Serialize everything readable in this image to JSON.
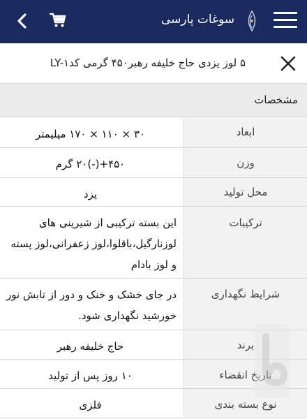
{
  "topbar": {
    "app_title": "سوغات پارسی",
    "icons": [
      "back-chevron-icon",
      "cart-icon",
      "logo-icon",
      "hamburger-menu-icon"
    ],
    "background": "#1b2a5e"
  },
  "product": {
    "title": "۵ لوز یزدی حاج خلیفه رهبر۴۵۰ گرمی کدLY-۱"
  },
  "specs": {
    "section_title": "مشخصات",
    "rows": [
      {
        "label": "ابعاد",
        "value": "۳۰ × ۱۱۰ × ۱۷۰ میلیمتر"
      },
      {
        "label": "وزن",
        "value": "۴۵۰+(-)۲۰ گرم"
      },
      {
        "label": "محل تولید",
        "value": "یزد"
      },
      {
        "label": "ترکیبات",
        "value": "این بسته ترکیبی از شیرینی های لوزنارگیل،باقلوا،لوز زعفرانی،لوز پسته و لوز بادام"
      },
      {
        "label": "شرایط نگهداری",
        "value": "در جای خشک و خنک و دور از تابش نور خورشید نگهداری شود."
      },
      {
        "label": "برند",
        "value": "حاج خلیفه رهبر"
      },
      {
        "label": "تاریخ انقضاء",
        "value": "۱۰ روز پس از تولید"
      },
      {
        "label": "نوع بسته بندی",
        "value": "فلزی"
      }
    ]
  }
}
